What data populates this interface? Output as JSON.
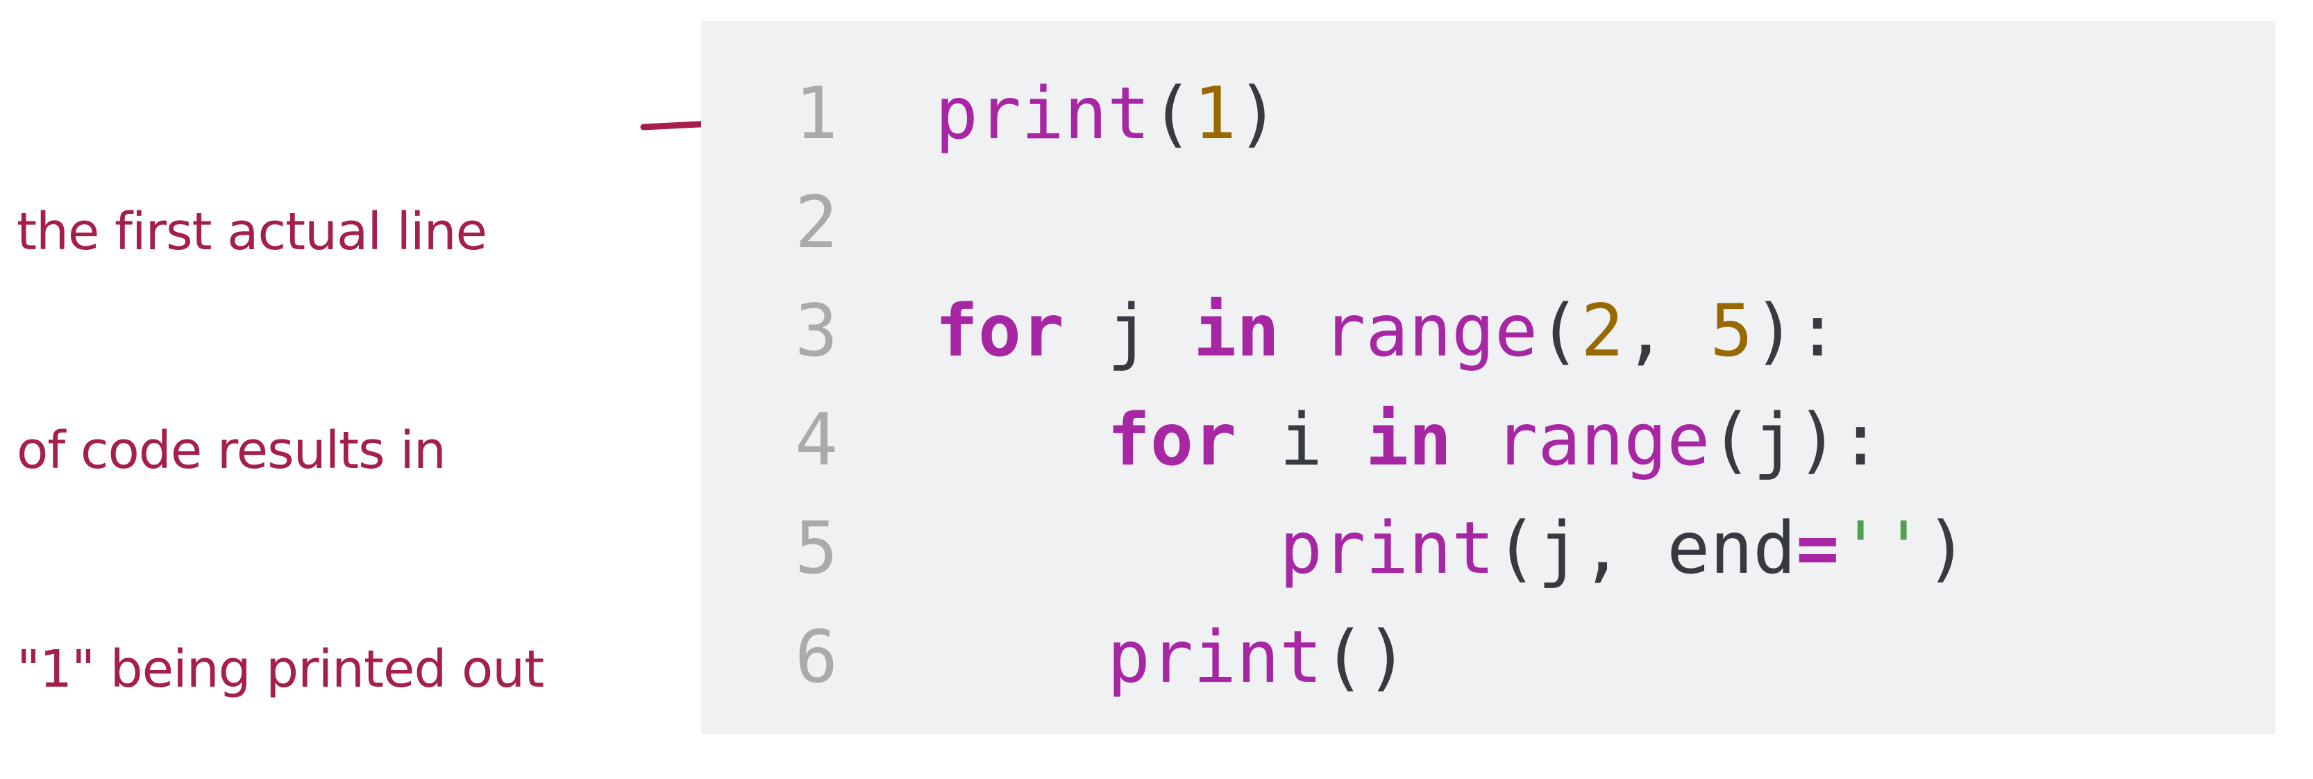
{
  "annotation": {
    "lines": [
      "the first actual line",
      "of code results in",
      "\"1\" being printed out"
    ],
    "color": "#a61e4d"
  },
  "code": {
    "language": "python",
    "colors": {
      "background": "#f0f1f3",
      "line_number": "#aaaaaa",
      "keyword": "#a626a4",
      "function": "#a626a4",
      "number": "#986801",
      "string": "#50a14f",
      "punctuation": "#383a42"
    },
    "lines": [
      {
        "number": "1",
        "tokens": [
          {
            "type": "fn",
            "text": "print"
          },
          {
            "type": "p",
            "text": "("
          },
          {
            "type": "num",
            "text": "1"
          },
          {
            "type": "p",
            "text": ")"
          }
        ]
      },
      {
        "number": "2",
        "tokens": []
      },
      {
        "number": "3",
        "tokens": [
          {
            "type": "kw",
            "text": "for"
          },
          {
            "type": "id",
            "text": " j "
          },
          {
            "type": "kw",
            "text": "in"
          },
          {
            "type": "id",
            "text": " "
          },
          {
            "type": "fn",
            "text": "range"
          },
          {
            "type": "p",
            "text": "("
          },
          {
            "type": "num",
            "text": "2"
          },
          {
            "type": "p",
            "text": ", "
          },
          {
            "type": "num",
            "text": "5"
          },
          {
            "type": "p",
            "text": "):"
          }
        ]
      },
      {
        "number": "4",
        "tokens": [
          {
            "type": "id",
            "text": "    "
          },
          {
            "type": "kw",
            "text": "for"
          },
          {
            "type": "id",
            "text": " i "
          },
          {
            "type": "kw",
            "text": "in"
          },
          {
            "type": "id",
            "text": " "
          },
          {
            "type": "fn",
            "text": "range"
          },
          {
            "type": "p",
            "text": "(j):"
          }
        ]
      },
      {
        "number": "5",
        "tokens": [
          {
            "type": "id",
            "text": "        "
          },
          {
            "type": "fn",
            "text": "print"
          },
          {
            "type": "p",
            "text": "(j, "
          },
          {
            "type": "id",
            "text": "end"
          },
          {
            "type": "op",
            "text": "="
          },
          {
            "type": "str",
            "text": "''"
          },
          {
            "type": "p",
            "text": ")"
          }
        ]
      },
      {
        "number": "6",
        "tokens": [
          {
            "type": "id",
            "text": "    "
          },
          {
            "type": "fn",
            "text": "print"
          },
          {
            "type": "p",
            "text": "()"
          }
        ]
      }
    ]
  }
}
